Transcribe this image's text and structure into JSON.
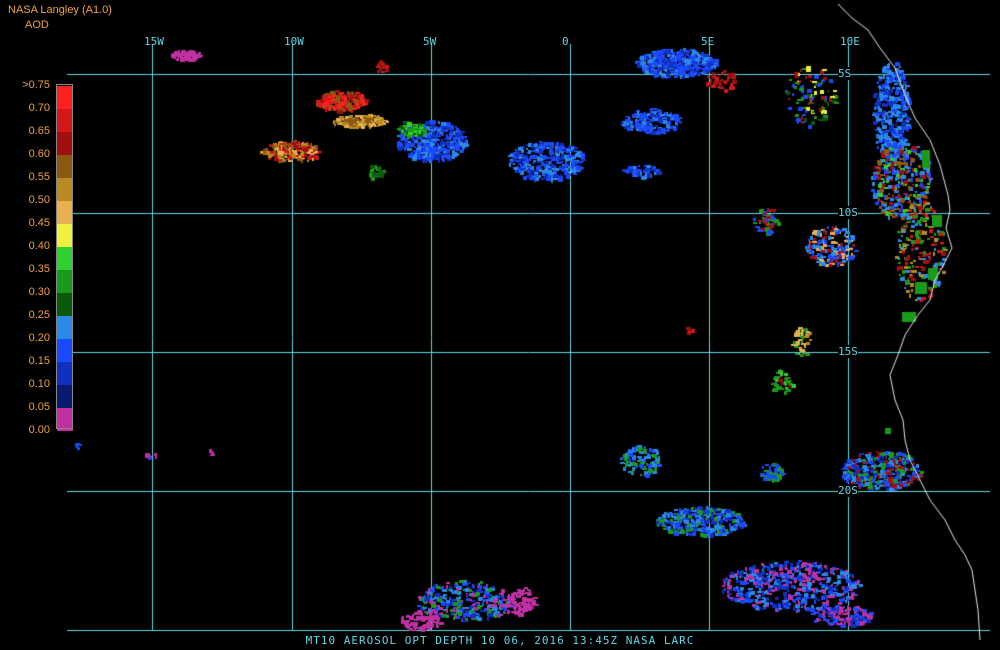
{
  "header": {
    "credit": "NASA Langley (A1.0)",
    "parameter": "AOD"
  },
  "legend": {
    "labels": [
      ">0.75",
      "0.70",
      "0.65",
      "0.60",
      "0.55",
      "0.50",
      "0.45",
      "0.40",
      "0.35",
      "0.30",
      "0.25",
      "0.20",
      "0.15",
      "0.10",
      "0.05",
      "0.00"
    ],
    "colors": [
      "#ff2020",
      "#d41818",
      "#a01010",
      "#8a5a10",
      "#b88a20",
      "#e8b050",
      "#f0f040",
      "#30d030",
      "#1a9a1a",
      "#0a5a0a",
      "#2a8ae8",
      "#1a4aff",
      "#1030c0",
      "#0a1a70",
      "#c030a0"
    ]
  },
  "graticule": {
    "lon_labels": [
      "15W",
      "10W",
      "5W",
      "0",
      "5E",
      "10E"
    ],
    "lat_labels": [
      "5S",
      "10S",
      "15S",
      "20S"
    ]
  },
  "footer": "MT10  AEROSOL OPT DEPTH   10 06, 2016 13:45Z   NASA LARC",
  "colors": {
    "grid": "#5ed8e4",
    "coast": "#e8e8e8",
    "label": "#f0a040"
  }
}
